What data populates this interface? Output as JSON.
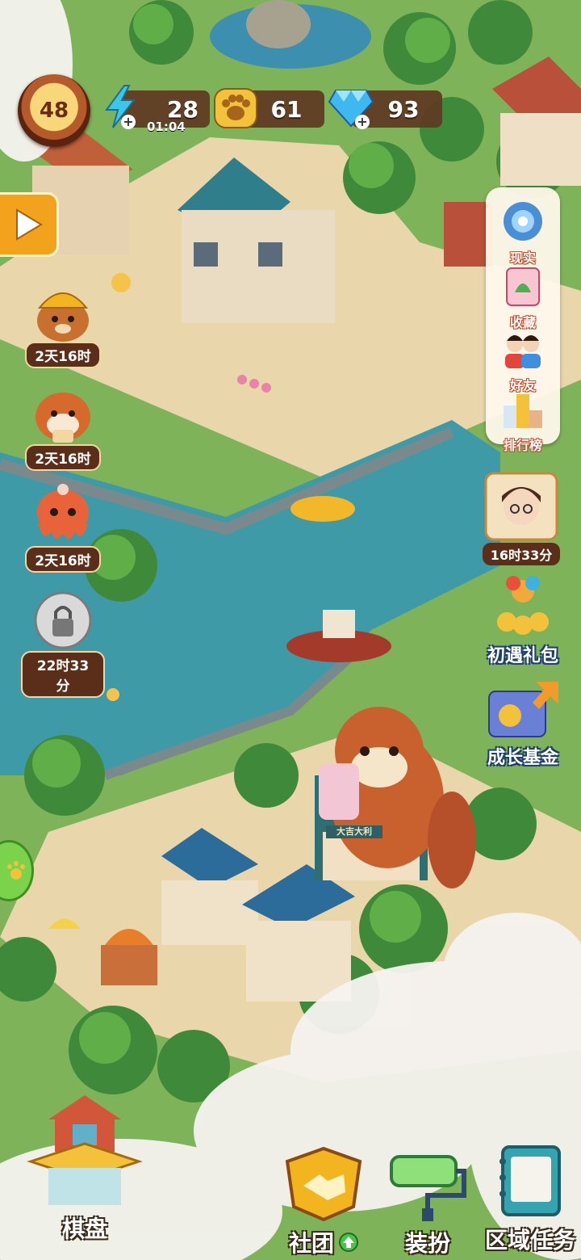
{
  "hud": {
    "level": "48",
    "energy": {
      "value": "28",
      "timer": "01:04",
      "icon": "lightning-icon"
    },
    "paws": {
      "value": "61",
      "icon": "paw-icon"
    },
    "gems": {
      "value": "93",
      "icon": "diamond-icon"
    }
  },
  "left_events": [
    {
      "label": "2天16时",
      "icon": "beaver-builder-icon"
    },
    {
      "label": "2天16时",
      "icon": "red-panda-icon"
    },
    {
      "label": "2天16时",
      "icon": "octopus-icon"
    },
    {
      "label": "22时33分",
      "icon": "locked-ball-icon"
    }
  ],
  "right_menu": [
    {
      "label": "现实",
      "icon": "portal-icon"
    },
    {
      "label": "收藏",
      "icon": "collection-icon"
    },
    {
      "label": "好友",
      "icon": "friends-icon"
    },
    {
      "label": "排行榜",
      "icon": "podium-icon"
    }
  ],
  "right_features": {
    "character_timer": "16时33分",
    "first_pack": "初遇礼包",
    "growth_fund": "成长基金"
  },
  "bottom": {
    "board": "棋盘",
    "club": "社团",
    "decorate": "装扮",
    "area_tasks": "区域任务",
    "shop_sign": "大吉大利"
  },
  "colors": {
    "water": "#3f9aa8",
    "grass": "#7fb35a",
    "path": "#e7d4a6",
    "hud_panel": "#60382280"
  }
}
